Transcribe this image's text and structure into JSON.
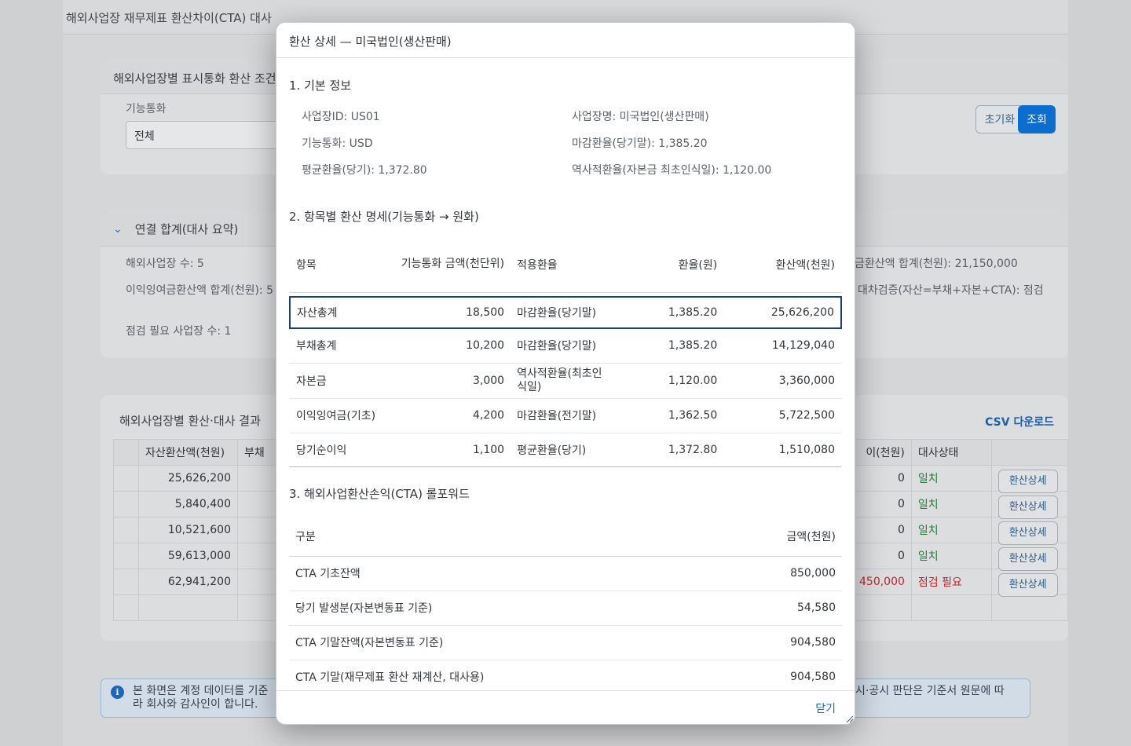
{
  "app": {
    "title": "해외사업장 재무제표 환산차이(CTA) 대사",
    "filter_panel": {
      "title": "해외사업장별 표시통화 환산 조건",
      "currency_label": "기능통화",
      "currency_value": "전체",
      "reset_label": "초기화",
      "search_label": "조회"
    },
    "summary": {
      "chevron": "⌄",
      "title": "연결 합계(대사 요약)",
      "entity_count": "해외사업장 수: 5",
      "retained_total": "이익잉여금환산액 합계(천원): 5",
      "check_needed": "점검 필요 사업장 수: 1",
      "right_line1": "금환산액 합계(천원): 21,150,000",
      "right_line2": "대차검증(자산=부채+자본+CTA): 점검"
    },
    "results": {
      "title": "해외사업장별 환산·대사 결과",
      "csv_label": "CSV 다운로드",
      "col_assets": "자산환산액(천원)",
      "col_liab": "부채",
      "col_diff": "이(천원)",
      "col_status": "대사상태",
      "rows": [
        {
          "assets": "25,626,200",
          "diff": "0",
          "status": "일치",
          "detail": "환산상세"
        },
        {
          "assets": "5,840,400",
          "diff": "0",
          "status": "일치",
          "detail": "환산상세"
        },
        {
          "assets": "10,521,600",
          "diff": "0",
          "status": "일치",
          "detail": "환산상세"
        },
        {
          "assets": "59,613,000",
          "diff": "0",
          "status": "일치",
          "detail": "환산상세"
        },
        {
          "assets": "62,941,200",
          "diff": "450,000",
          "status": "점검 필요",
          "detail": "환산상세"
        }
      ]
    },
    "info": {
      "icon": "i",
      "line1_left": "본 화면은 계정 데이터를 기준",
      "line2_left": "라 회사와 감사인이 합니다.",
      "line1_right": "시·공시 판단은 기준서 원문에 따"
    },
    "colors": {
      "match": "#2b7a3d",
      "mismatch": "#c0262d",
      "accent": "#0a6ed1"
    }
  },
  "dialog": {
    "title": "환산 상세 — 미국법인(생산판매)",
    "basic": {
      "title": "1. 기본 정보",
      "entity_id": "사업장ID: US01",
      "entity_name": "사업장명: 미국법인(생산판매)",
      "functional_currency": "기능통화: USD",
      "closing_rate": "마감환율(당기말): 1,385.20",
      "average_rate": "평균환율(당기): 1,372.80",
      "historical_rate": "역사적환율(자본금 최초인식일): 1,120.00"
    },
    "items": {
      "title": "2. 항목별 환산 명세(기능통화 → 원화)",
      "headers": {
        "item": "항목",
        "fc_amount": "기능통화 금액(천단위)",
        "rate_type": "적용환율",
        "rate": "환율(원)",
        "krw": "환산액(천원)"
      },
      "rows": [
        {
          "item": "자산총계",
          "fc": "18,500",
          "rate_type": "마감환율(당기말)",
          "rate": "1,385.20",
          "krw": "25,626,200"
        },
        {
          "item": "부채총계",
          "fc": "10,200",
          "rate_type": "마감환율(당기말)",
          "rate": "1,385.20",
          "krw": "14,129,040"
        },
        {
          "item": "자본금",
          "fc": "3,000",
          "rate_type": "역사적환율(최초인식일)",
          "rate": "1,120.00",
          "krw": "3,360,000"
        },
        {
          "item": "이익잉여금(기초)",
          "fc": "4,200",
          "rate_type": "마감환율(전기말)",
          "rate": "1,362.50",
          "krw": "5,722,500"
        },
        {
          "item": "당기순이익",
          "fc": "1,100",
          "rate_type": "평균환율(당기)",
          "rate": "1,372.80",
          "krw": "1,510,080"
        }
      ]
    },
    "cta": {
      "title": "3. 해외사업환산손익(CTA) 롤포워드",
      "headers": {
        "label": "구분",
        "amount": "금액(천원)"
      },
      "rows": [
        {
          "label": "CTA 기초잔액",
          "amount": "850,000"
        },
        {
          "label": "당기 발생분(자본변동표 기준)",
          "amount": "54,580"
        },
        {
          "label": "CTA 기말잔액(자본변동표 기준)",
          "amount": "904,580"
        },
        {
          "label": "CTA 기말(재무제표 환산 재계산, 대사용)",
          "amount": "904,580"
        }
      ]
    },
    "close_label": "닫기"
  }
}
